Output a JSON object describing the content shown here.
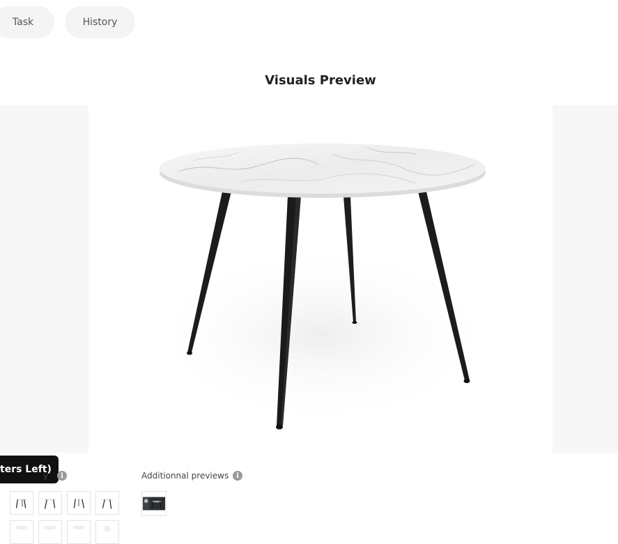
{
  "tabs": [
    {
      "label": "Task"
    },
    {
      "label": "History"
    }
  ],
  "page": {
    "title": "Visuals Preview"
  },
  "tooltip": {
    "text": "ters Left)"
  },
  "gallery": {
    "label_fragment": "y"
  },
  "additional": {
    "label": "Additionnal previews"
  },
  "info_glyph": "i",
  "icons": {
    "info": "info-icon"
  },
  "colors": {
    "leg": "#1c1c1c",
    "marble": "#f2f2f2",
    "tooltip_bg": "#111111",
    "tab_bg": "#f4f4f4"
  }
}
